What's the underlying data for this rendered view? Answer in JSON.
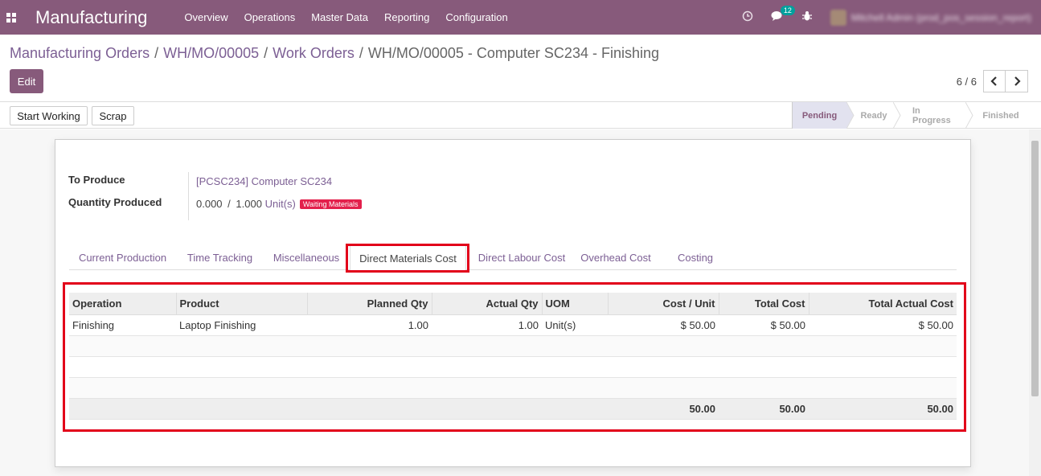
{
  "navbar": {
    "app_title": "Manufacturing",
    "menu": [
      "Overview",
      "Operations",
      "Master Data",
      "Reporting",
      "Configuration"
    ],
    "chat_badge": "12",
    "user_name": "Mitchell Admin (prod_pos_session_report)"
  },
  "breadcrumb": {
    "items": [
      "Manufacturing Orders",
      "WH/MO/00005",
      "Work Orders"
    ],
    "current": "WH/MO/00005 - Computer SC234 - Finishing"
  },
  "actions": {
    "edit_label": "Edit"
  },
  "pager": {
    "value": "6 / 6"
  },
  "statusbar": {
    "buttons": [
      "Start Working",
      "Scrap"
    ],
    "stages": [
      "Pending",
      "Ready",
      "In Progress",
      "Finished"
    ],
    "active_stage": "Pending"
  },
  "form": {
    "to_produce_label": "To Produce",
    "to_produce_value": "[PCSC234] Computer SC234",
    "qty_label": "Quantity Produced",
    "qty_done": "0.000",
    "qty_sep": "/",
    "qty_total": "1.000",
    "qty_uom": "Unit(s)",
    "qty_badge": "Waiting Materials"
  },
  "tabs": [
    "Current Production",
    "Time Tracking",
    "Miscellaneous",
    "Direct Materials Cost",
    "Direct Labour Cost",
    "Overhead Cost",
    "Costing"
  ],
  "active_tab": "Direct Materials Cost",
  "table": {
    "headers": [
      "Operation",
      "Product",
      "Planned Qty",
      "Actual Qty",
      "UOM",
      "Cost / Unit",
      "Total Cost",
      "Total Actual Cost"
    ],
    "rows": [
      [
        "Finishing",
        "Laptop Finishing",
        "1.00",
        "1.00",
        "Unit(s)",
        "$ 50.00",
        "$ 50.00",
        "$ 50.00"
      ]
    ],
    "footer": [
      "",
      "",
      "",
      "",
      "",
      "50.00",
      "50.00",
      "50.00"
    ]
  },
  "colors": {
    "brand": "#875a7b",
    "highlight": "#e2001a",
    "badge": "#e3204c"
  }
}
